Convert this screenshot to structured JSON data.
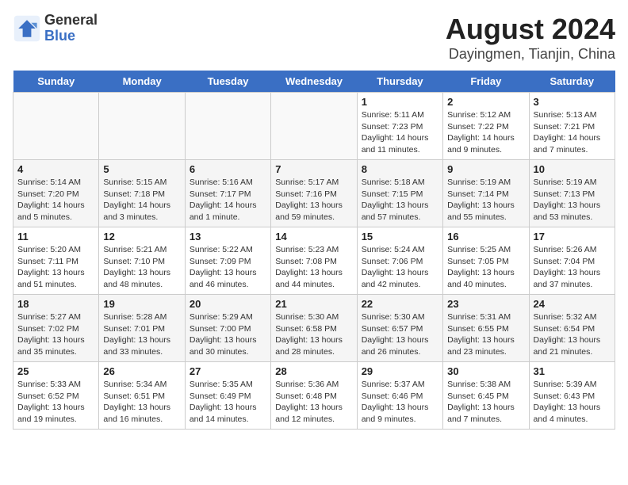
{
  "logo": {
    "line1": "General",
    "line2": "Blue"
  },
  "title": "August 2024",
  "subtitle": "Dayingmen, Tianjin, China",
  "weekdays": [
    "Sunday",
    "Monday",
    "Tuesday",
    "Wednesday",
    "Thursday",
    "Friday",
    "Saturday"
  ],
  "weeks": [
    [
      {
        "day": "",
        "info": ""
      },
      {
        "day": "",
        "info": ""
      },
      {
        "day": "",
        "info": ""
      },
      {
        "day": "",
        "info": ""
      },
      {
        "day": "1",
        "info": "Sunrise: 5:11 AM\nSunset: 7:23 PM\nDaylight: 14 hours\nand 11 minutes."
      },
      {
        "day": "2",
        "info": "Sunrise: 5:12 AM\nSunset: 7:22 PM\nDaylight: 14 hours\nand 9 minutes."
      },
      {
        "day": "3",
        "info": "Sunrise: 5:13 AM\nSunset: 7:21 PM\nDaylight: 14 hours\nand 7 minutes."
      }
    ],
    [
      {
        "day": "4",
        "info": "Sunrise: 5:14 AM\nSunset: 7:20 PM\nDaylight: 14 hours\nand 5 minutes."
      },
      {
        "day": "5",
        "info": "Sunrise: 5:15 AM\nSunset: 7:18 PM\nDaylight: 14 hours\nand 3 minutes."
      },
      {
        "day": "6",
        "info": "Sunrise: 5:16 AM\nSunset: 7:17 PM\nDaylight: 14 hours\nand 1 minute."
      },
      {
        "day": "7",
        "info": "Sunrise: 5:17 AM\nSunset: 7:16 PM\nDaylight: 13 hours\nand 59 minutes."
      },
      {
        "day": "8",
        "info": "Sunrise: 5:18 AM\nSunset: 7:15 PM\nDaylight: 13 hours\nand 57 minutes."
      },
      {
        "day": "9",
        "info": "Sunrise: 5:19 AM\nSunset: 7:14 PM\nDaylight: 13 hours\nand 55 minutes."
      },
      {
        "day": "10",
        "info": "Sunrise: 5:19 AM\nSunset: 7:13 PM\nDaylight: 13 hours\nand 53 minutes."
      }
    ],
    [
      {
        "day": "11",
        "info": "Sunrise: 5:20 AM\nSunset: 7:11 PM\nDaylight: 13 hours\nand 51 minutes."
      },
      {
        "day": "12",
        "info": "Sunrise: 5:21 AM\nSunset: 7:10 PM\nDaylight: 13 hours\nand 48 minutes."
      },
      {
        "day": "13",
        "info": "Sunrise: 5:22 AM\nSunset: 7:09 PM\nDaylight: 13 hours\nand 46 minutes."
      },
      {
        "day": "14",
        "info": "Sunrise: 5:23 AM\nSunset: 7:08 PM\nDaylight: 13 hours\nand 44 minutes."
      },
      {
        "day": "15",
        "info": "Sunrise: 5:24 AM\nSunset: 7:06 PM\nDaylight: 13 hours\nand 42 minutes."
      },
      {
        "day": "16",
        "info": "Sunrise: 5:25 AM\nSunset: 7:05 PM\nDaylight: 13 hours\nand 40 minutes."
      },
      {
        "day": "17",
        "info": "Sunrise: 5:26 AM\nSunset: 7:04 PM\nDaylight: 13 hours\nand 37 minutes."
      }
    ],
    [
      {
        "day": "18",
        "info": "Sunrise: 5:27 AM\nSunset: 7:02 PM\nDaylight: 13 hours\nand 35 minutes."
      },
      {
        "day": "19",
        "info": "Sunrise: 5:28 AM\nSunset: 7:01 PM\nDaylight: 13 hours\nand 33 minutes."
      },
      {
        "day": "20",
        "info": "Sunrise: 5:29 AM\nSunset: 7:00 PM\nDaylight: 13 hours\nand 30 minutes."
      },
      {
        "day": "21",
        "info": "Sunrise: 5:30 AM\nSunset: 6:58 PM\nDaylight: 13 hours\nand 28 minutes."
      },
      {
        "day": "22",
        "info": "Sunrise: 5:30 AM\nSunset: 6:57 PM\nDaylight: 13 hours\nand 26 minutes."
      },
      {
        "day": "23",
        "info": "Sunrise: 5:31 AM\nSunset: 6:55 PM\nDaylight: 13 hours\nand 23 minutes."
      },
      {
        "day": "24",
        "info": "Sunrise: 5:32 AM\nSunset: 6:54 PM\nDaylight: 13 hours\nand 21 minutes."
      }
    ],
    [
      {
        "day": "25",
        "info": "Sunrise: 5:33 AM\nSunset: 6:52 PM\nDaylight: 13 hours\nand 19 minutes."
      },
      {
        "day": "26",
        "info": "Sunrise: 5:34 AM\nSunset: 6:51 PM\nDaylight: 13 hours\nand 16 minutes."
      },
      {
        "day": "27",
        "info": "Sunrise: 5:35 AM\nSunset: 6:49 PM\nDaylight: 13 hours\nand 14 minutes."
      },
      {
        "day": "28",
        "info": "Sunrise: 5:36 AM\nSunset: 6:48 PM\nDaylight: 13 hours\nand 12 minutes."
      },
      {
        "day": "29",
        "info": "Sunrise: 5:37 AM\nSunset: 6:46 PM\nDaylight: 13 hours\nand 9 minutes."
      },
      {
        "day": "30",
        "info": "Sunrise: 5:38 AM\nSunset: 6:45 PM\nDaylight: 13 hours\nand 7 minutes."
      },
      {
        "day": "31",
        "info": "Sunrise: 5:39 AM\nSunset: 6:43 PM\nDaylight: 13 hours\nand 4 minutes."
      }
    ]
  ]
}
